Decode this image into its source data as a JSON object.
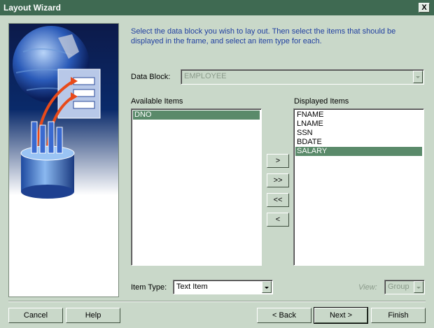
{
  "window": {
    "title": "Layout Wizard",
    "close_label": "X"
  },
  "instructions": "Select the data block you wish to lay out. Then select the items that should be displayed in the frame, and select an item type for each.",
  "data_block": {
    "label": "Data Block:",
    "value": "EMPLOYEE"
  },
  "available_items": {
    "label": "Available Items",
    "items": [
      "DNO"
    ],
    "selected_index": 0
  },
  "displayed_items": {
    "label": "Displayed Items",
    "items": [
      "FNAME",
      "LNAME",
      "SSN",
      "BDATE",
      "SALARY"
    ],
    "selected_index": 4
  },
  "move_buttons": {
    "add_one": ">",
    "add_all": ">>",
    "remove_all": "<<",
    "remove_one": "<"
  },
  "item_type": {
    "label": "Item Type:",
    "value": "Text Item"
  },
  "view": {
    "label": "View:",
    "value": "Group"
  },
  "footer": {
    "cancel": "Cancel",
    "help": "Help",
    "back": "< Back",
    "next": "Next >",
    "finish": "Finish"
  },
  "colors": {
    "titlebar": "#3f6a52",
    "background": "#c9d8c9",
    "instruction_text": "#203fa0",
    "selection": "#5a8a6a"
  }
}
